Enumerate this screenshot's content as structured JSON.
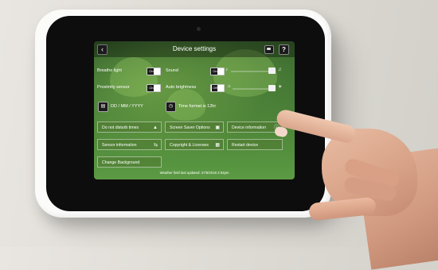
{
  "screen": {
    "title": "Device settings",
    "back_icon": "chevron-left-icon",
    "footer_text": "Weather field last updated: 27/6/2018 2:02pm"
  },
  "rows": {
    "breathe_light_label": "Breathe light",
    "breathe_toggle": "On",
    "sound_label": "Sound",
    "sound_toggle": "On",
    "proximity_label": "Proximity sensor",
    "proximity_toggle": "On",
    "auto_brightness_label": "Auto brightness",
    "auto_brightness_toggle": "Off"
  },
  "format": {
    "date_format": "DD / MM / YYYY",
    "time_format": "Time format is 12hr"
  },
  "buttons": {
    "do_not_disturb": "Do not disturb times",
    "screen_saver": "Screen Saver Options",
    "device_info": "Device information",
    "sensor_info": "Sensor information",
    "copyright": "Copyright & Licenses",
    "restart": "Restart device",
    "change_background": "Change Background"
  }
}
